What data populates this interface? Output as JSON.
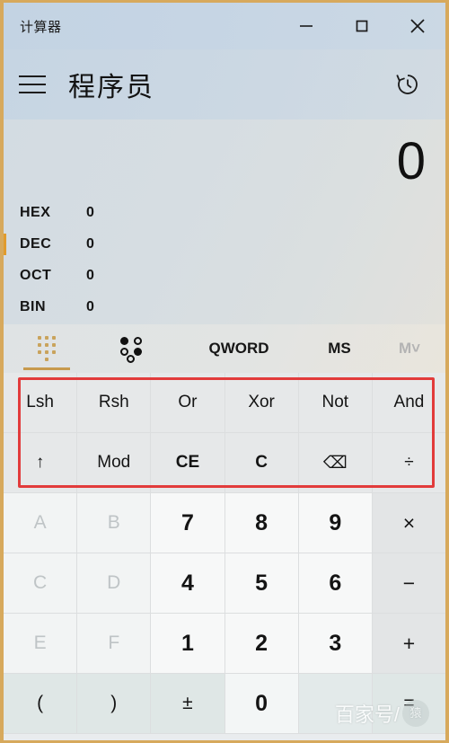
{
  "window": {
    "title": "计算器",
    "controls": [
      {
        "name": "minimize",
        "glyph": "—"
      },
      {
        "name": "maximize",
        "glyph": "□"
      },
      {
        "name": "close",
        "glyph": "✕"
      }
    ]
  },
  "header": {
    "menu_icon": "hamburger-icon",
    "mode_title": "程序员",
    "history_icon": "history-icon"
  },
  "display": {
    "main_value": "0",
    "radix": [
      {
        "label": "HEX",
        "value": "0",
        "selected": false
      },
      {
        "label": "DEC",
        "value": "0",
        "selected": true
      },
      {
        "label": "OCT",
        "value": "0",
        "selected": false
      },
      {
        "label": "BIN",
        "value": "0",
        "selected": false
      }
    ]
  },
  "toolbar": {
    "keypad_icon": "keypad-dots-icon",
    "bitflip_icon": "bit-toggle-icon",
    "word_size": "QWORD",
    "memory_store": "MS",
    "memory_menu": "M˅",
    "selected": "keypad"
  },
  "keypad": {
    "rows": [
      [
        {
          "label": "Lsh",
          "kind": "func"
        },
        {
          "label": "Rsh",
          "kind": "func"
        },
        {
          "label": "Or",
          "kind": "func"
        },
        {
          "label": "Xor",
          "kind": "func"
        },
        {
          "label": "Not",
          "kind": "func"
        },
        {
          "label": "And",
          "kind": "func"
        }
      ],
      [
        {
          "label": "↑",
          "kind": "func"
        },
        {
          "label": "Mod",
          "kind": "func"
        },
        {
          "label": "CE",
          "kind": "func-bold"
        },
        {
          "label": "C",
          "kind": "func-bold"
        },
        {
          "label": "⌫",
          "kind": "func"
        },
        {
          "label": "÷",
          "kind": "func"
        }
      ],
      [
        {
          "label": "A",
          "kind": "hex-disabled"
        },
        {
          "label": "B",
          "kind": "hex-disabled"
        },
        {
          "label": "7",
          "kind": "num"
        },
        {
          "label": "8",
          "kind": "num"
        },
        {
          "label": "9",
          "kind": "num"
        },
        {
          "label": "×",
          "kind": "op"
        }
      ],
      [
        {
          "label": "C",
          "kind": "hex-disabled"
        },
        {
          "label": "D",
          "kind": "hex-disabled"
        },
        {
          "label": "4",
          "kind": "num"
        },
        {
          "label": "5",
          "kind": "num"
        },
        {
          "label": "6",
          "kind": "num"
        },
        {
          "label": "−",
          "kind": "op"
        }
      ],
      [
        {
          "label": "E",
          "kind": "hex-disabled"
        },
        {
          "label": "F",
          "kind": "hex-disabled"
        },
        {
          "label": "1",
          "kind": "num"
        },
        {
          "label": "2",
          "kind": "num"
        },
        {
          "label": "3",
          "kind": "num"
        },
        {
          "label": "+",
          "kind": "op"
        }
      ],
      [
        {
          "label": "(",
          "kind": "bottom"
        },
        {
          "label": ")",
          "kind": "bottom"
        },
        {
          "label": "±",
          "kind": "bottom"
        },
        {
          "label": "0",
          "kind": "zero"
        },
        {
          "label": "",
          "kind": "blank"
        },
        {
          "label": "=",
          "kind": "bottom"
        }
      ]
    ]
  },
  "annotation": {
    "highlight_color": "#e23b3b",
    "highlights_rows": [
      "Lsh Rsh Or Xor Not And",
      "↑ Mod CE C ⌫ ÷"
    ]
  },
  "watermark": {
    "text": "百家号/",
    "logo_text": "猿"
  },
  "colors": {
    "accent": "#e09b2d",
    "frame": "#d7a95c",
    "titlebar": "#c6d5e4",
    "annotation": "#e23b3b"
  }
}
